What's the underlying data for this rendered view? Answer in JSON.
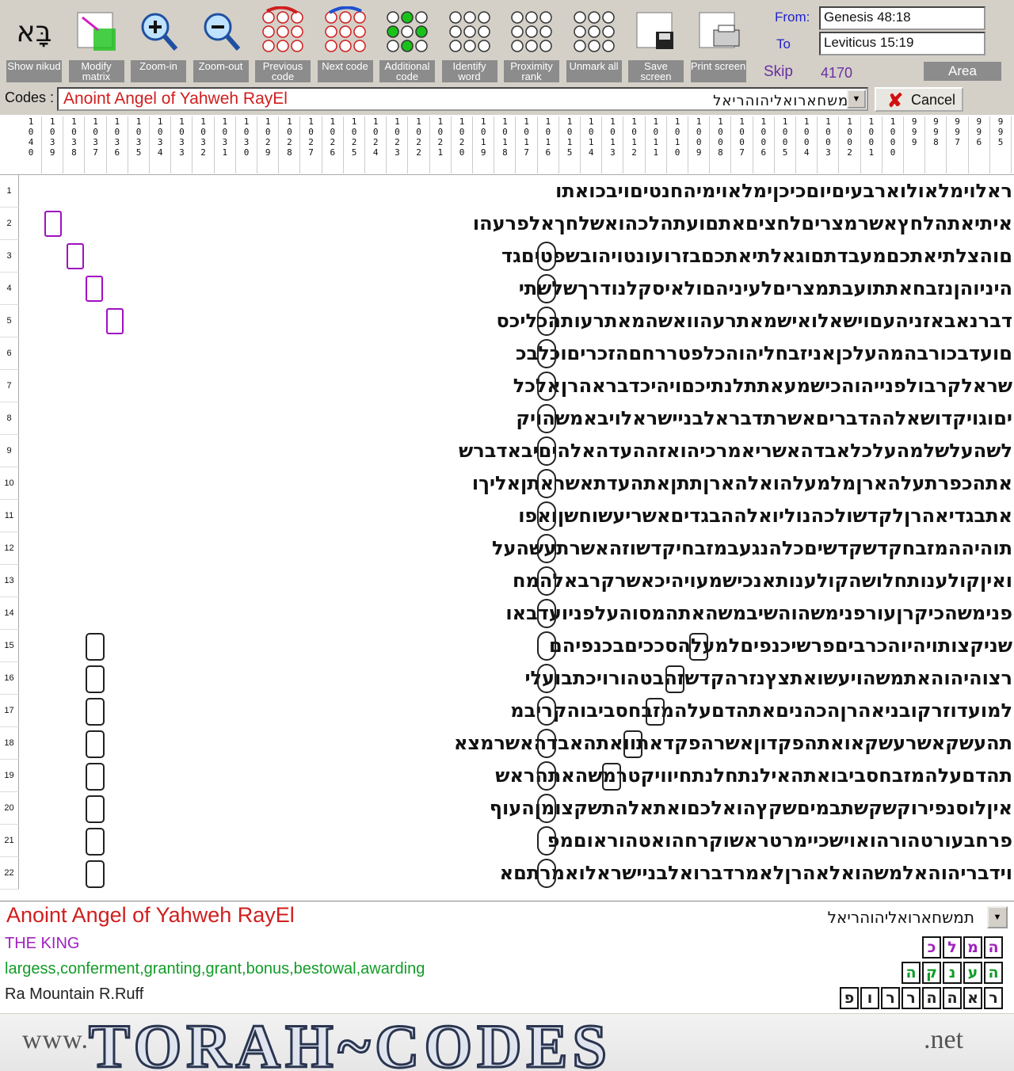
{
  "toolbar": [
    {
      "name": "show-nikud-button",
      "icon": "hebrew-nikud-icon",
      "label": "Show nikud"
    },
    {
      "name": "modify-matrix-button",
      "icon": "matrix-grid-icon",
      "label": "Modify matrix"
    },
    {
      "name": "zoom-in-button",
      "icon": "zoom-in-icon",
      "label": "Zoom-in"
    },
    {
      "name": "zoom-out-button",
      "icon": "zoom-out-icon",
      "label": "Zoom-out"
    },
    {
      "name": "previous-code-button",
      "icon": "previous-code-icon",
      "label": "Previous code"
    },
    {
      "name": "next-code-button",
      "icon": "next-code-icon",
      "label": "Next code"
    },
    {
      "name": "additional-code-button",
      "icon": "additional-code-icon",
      "label": "Additional code"
    },
    {
      "name": "identify-word-button",
      "icon": "identify-word-icon",
      "label": "Identify word"
    },
    {
      "name": "proximity-rank-button",
      "icon": "proximity-rank-icon",
      "label": "Proximity rank"
    },
    {
      "name": "unmark-all-button",
      "icon": "unmark-all-icon",
      "label": "Unmark all"
    },
    {
      "name": "save-screen-button",
      "icon": "save-floppy-icon",
      "label": "Save screen"
    },
    {
      "name": "print-screen-button",
      "icon": "printer-icon",
      "label": "Print screen"
    }
  ],
  "range": {
    "from_label": "From:",
    "from_value": "Genesis 48:18",
    "to_label": "To",
    "to_value": "Leviticus 15:19",
    "skip_label": "Skip",
    "skip_value": "4170",
    "area_label": "Area"
  },
  "codes": {
    "label": "Codes :",
    "value": "Anoint Angel of Yahweh RayEl",
    "hebrew": "תמשחארואליהוהריאל",
    "cancel_label": "Cancel"
  },
  "columns": [
    "1040",
    "1039",
    "1038",
    "1037",
    "1036",
    "1035",
    "1034",
    "1033",
    "1032",
    "1031",
    "1030",
    "1029",
    "1028",
    "1027",
    "1026",
    "1025",
    "1024",
    "1023",
    "1022",
    "1021",
    "1020",
    "1019",
    "1018",
    "1017",
    "1016",
    "1015",
    "1014",
    "1013",
    "1012",
    "1011",
    "1010",
    "1009",
    "1008",
    "1007",
    "1006",
    "1005",
    "1004",
    "1003",
    "1002",
    "1001",
    "1000",
    "999",
    "998",
    "997",
    "996",
    "995"
  ],
  "rows": [
    {
      "n": "1",
      "text": "ראלוימלאולוארבעיםיוםכיכןימלאוימיהחנטיםויבכואתו"
    },
    {
      "n": "2",
      "text": "איתיאתהלחץאשרמצריםלחציםאתםועתהלכהואשלחךאלפרעהו"
    },
    {
      "n": "3",
      "text": "םוהצלתיאתכםמעבדתםוגאלתיאתכםבזרועונטויהובשפטיםגד"
    },
    {
      "n": "4",
      "text": "היניוהןנזבחאתתועבתמצריםלעיניהםולאיסקלנודרךשלשתי"
    },
    {
      "n": "5",
      "text": "דברנאבאזניהעםוישאלואישמאתרעהוואשהמאתרעותהכליכס"
    },
    {
      "n": "6",
      "text": "םועדבכורבהמהעלכןאניזבחליהוהכלפטררחםהזכריםוכלבכ"
    },
    {
      "n": "7",
      "text": "שראלקרבולפנייהוהכישמעאתתלנתיכםויהיכדבראהרןאלכל"
    },
    {
      "n": "8",
      "text": "יםוגויקדושאלההדבריםאשרתדבראלבניישראלויבאמשהויק"
    },
    {
      "n": "9",
      "text": "לשהעלשלמהעלכלאבדהאשריאמרכיהואזההעדהאלהיםיבאדברש"
    },
    {
      "n": "10",
      "text": "אתהכפרתעלהארןמלמעלהואלהארןתתןאתהעדתאשראתןאליךו"
    },
    {
      "n": "11",
      "text": "אתבגדיאהרןלקדשולכהנוליואלההבגדיםאשריעשוחשןואפו"
    },
    {
      "n": "12",
      "text": "תוהיההמזבחקדשקדשיםכלהנגעבמזבחיקדשוזהאשרתעשהעל"
    },
    {
      "n": "13",
      "text": "ואיןקולענותחלושהקולענותאנכישמעויהיכאשרקרבאלהמח"
    },
    {
      "n": "14",
      "text": "פנימשהכיקרןעורפנימשהוהשיבמשהאתהמסוהעלפניועדבאו"
    },
    {
      "n": "15",
      "text": "שניקצותויהיוהכרביםפרשיכנפיםלמעלהסככיםבכנפיהם"
    },
    {
      "n": "16",
      "text": "רצוהיהוהאתמשהויעשואתצץנזרהקדשזהבטהורויכתבועלי"
    },
    {
      "n": "17",
      "text": "למועדוזרקובניאהרןהכהניםאתהדםעלהמזבחסביבוהקריבמ"
    },
    {
      "n": "18",
      "text": "תהעשקאשרעשקאואתהפקדוןאשרהפקדאתוואתהאבדהאשרמצא"
    },
    {
      "n": "19",
      "text": "תהדםעלהמזבחסביבואתהאילנתחלנתחיוויקטרמשהאתהראש"
    },
    {
      "n": "20",
      "text": "איןלוסנפירוקשקשתבמיםשקץהואלכםואתאלהתשקצומןהעוף"
    },
    {
      "n": "21",
      "text": "פרחבעורטהורהואוישכיימרטראשוקרחהואטהוראוםמפ"
    },
    {
      "n": "22",
      "text": "וידבריהוהאלמשהואלאהרןלאמרדברואלבניישראלואמרתםא"
    }
  ],
  "result": {
    "title": "Anoint Angel of Yahweh RayEl",
    "hebrew": "תמשחארואליהוהריאל",
    "lines": [
      {
        "text": "THE KING",
        "color": "#a020c0",
        "boxes": [
          "ה",
          "מ",
          "ל",
          "כ"
        ]
      },
      {
        "text": "largess,conferment,granting,grant,bonus,bestowal,awarding",
        "color": "#129c28",
        "boxes": [
          "ה",
          "ע",
          "נ",
          "ק",
          "ה"
        ]
      },
      {
        "text": "Ra Mountain R.Ruff",
        "color": "#222",
        "boxes": [
          "ר",
          "א",
          "ה",
          "ה",
          "ר",
          "ר",
          "ו",
          "פ"
        ]
      }
    ]
  },
  "banner": {
    "www": "www.",
    "logo": "TORAH~CODES",
    ".net": ".net"
  },
  "colors": {
    "code_red": "#d01e1e",
    "matrix_text": "#111111",
    "button_gray": "#8c8c8c",
    "purple": "#a020c0",
    "green": "#129c28"
  }
}
